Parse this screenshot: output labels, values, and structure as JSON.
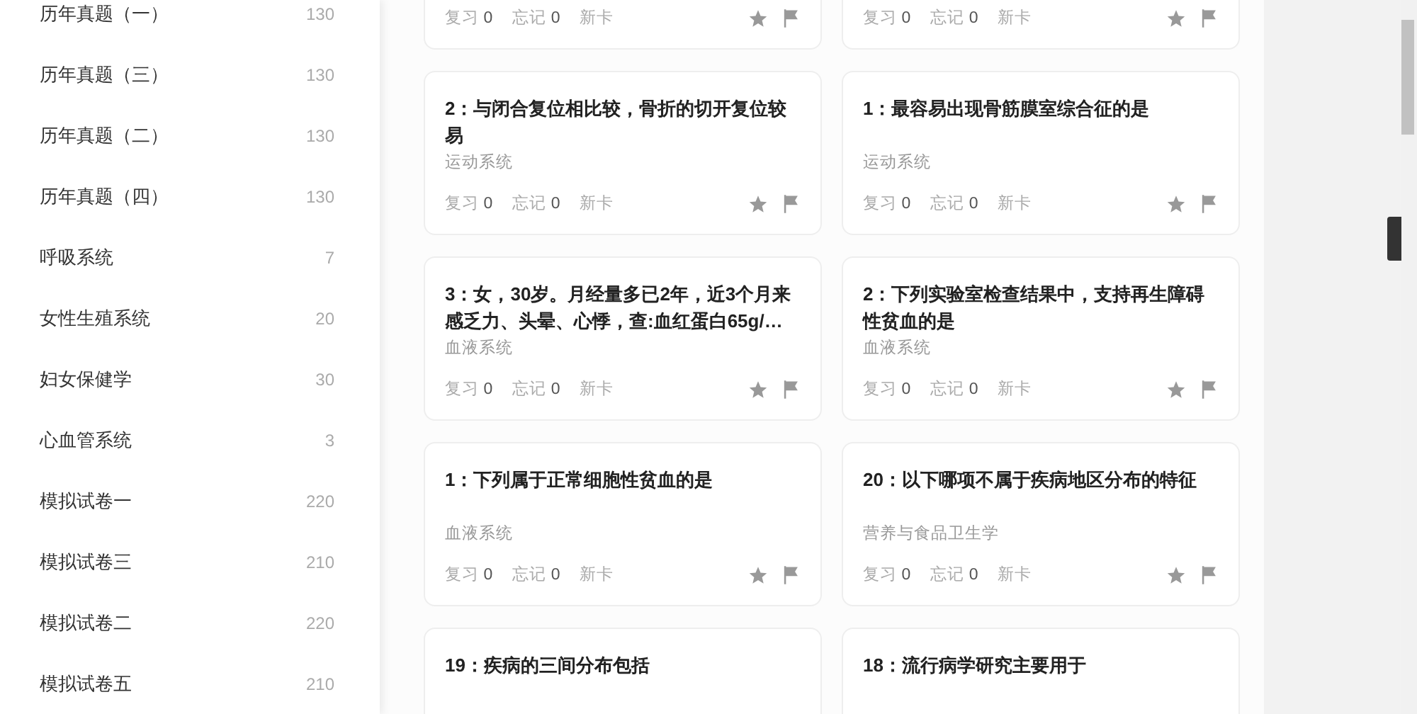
{
  "sidebar": {
    "items": [
      {
        "label": "历年真题（一）",
        "count": "130"
      },
      {
        "label": "历年真题（三）",
        "count": "130"
      },
      {
        "label": "历年真题（二）",
        "count": "130"
      },
      {
        "label": "历年真题（四）",
        "count": "130"
      },
      {
        "label": "呼吸系统",
        "count": "7"
      },
      {
        "label": "女性生殖系统",
        "count": "20"
      },
      {
        "label": "妇女保健学",
        "count": "30"
      },
      {
        "label": "心血管系统",
        "count": "3"
      },
      {
        "label": "模拟试卷一",
        "count": "220"
      },
      {
        "label": "模拟试卷三",
        "count": "210"
      },
      {
        "label": "模拟试卷二",
        "count": "220"
      },
      {
        "label": "模拟试卷五",
        "count": "210"
      }
    ]
  },
  "cards": [
    {
      "stats": [
        {
          "label": "复习",
          "value": "0"
        },
        {
          "label": "忘记",
          "value": "0"
        },
        {
          "label": "新卡"
        }
      ]
    },
    {
      "stats": [
        {
          "label": "复习",
          "value": "0"
        },
        {
          "label": "忘记",
          "value": "0"
        },
        {
          "label": "新卡"
        }
      ]
    },
    {
      "title": "2：与闭合复位相比较，骨折的切开复位较易",
      "category": "运动系统",
      "stats": [
        {
          "label": "复习",
          "value": "0"
        },
        {
          "label": "忘记",
          "value": "0"
        },
        {
          "label": "新卡"
        }
      ]
    },
    {
      "title": "1：最容易出现骨筋膜室综合征的是",
      "category": "运动系统",
      "stats": [
        {
          "label": "复习",
          "value": "0"
        },
        {
          "label": "忘记",
          "value": "0"
        },
        {
          "label": "新卡"
        }
      ]
    },
    {
      "title": "3：女，30岁。月经量多已2年，近3个月来感乏力、头晕、心悸，查:血红蛋白65g/…",
      "category": "血液系统",
      "stats": [
        {
          "label": "复习",
          "value": "0"
        },
        {
          "label": "忘记",
          "value": "0"
        },
        {
          "label": "新卡"
        }
      ]
    },
    {
      "title": "2：下列实验室检查结果中，支持再生障碍性贫血的是",
      "category": "血液系统",
      "stats": [
        {
          "label": "复习",
          "value": "0"
        },
        {
          "label": "忘记",
          "value": "0"
        },
        {
          "label": "新卡"
        }
      ]
    },
    {
      "title": "1：下列属于正常细胞性贫血的是",
      "category": "血液系统",
      "stats": [
        {
          "label": "复习",
          "value": "0"
        },
        {
          "label": "忘记",
          "value": "0"
        },
        {
          "label": "新卡"
        }
      ]
    },
    {
      "title": "20：以下哪项不属于疾病地区分布的特征",
      "category": "营养与食品卫生学",
      "stats": [
        {
          "label": "复习",
          "value": "0"
        },
        {
          "label": "忘记",
          "value": "0"
        },
        {
          "label": "新卡"
        }
      ]
    },
    {
      "title": "19：疾病的三间分布包括"
    },
    {
      "title": "18：流行病学研究主要用于"
    }
  ]
}
